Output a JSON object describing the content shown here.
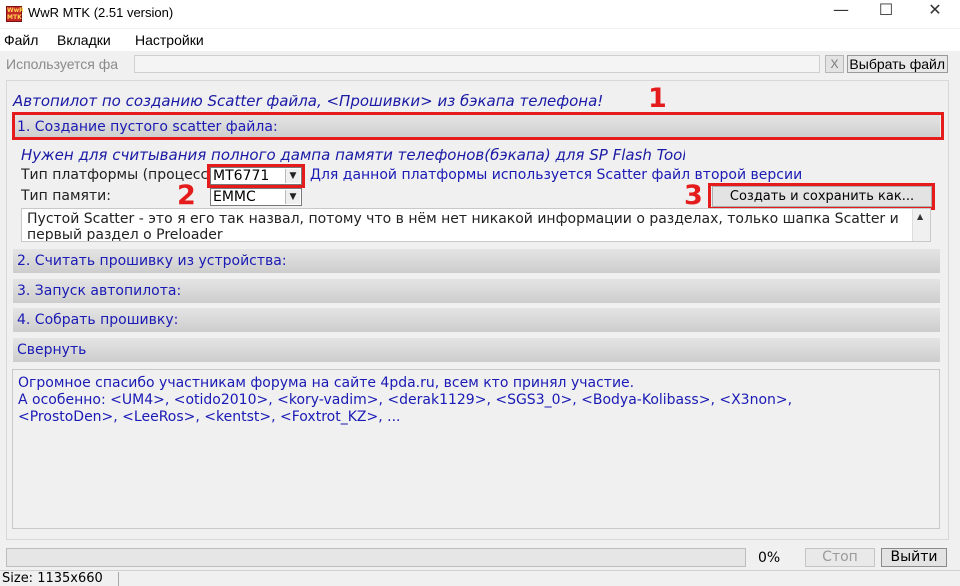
{
  "window": {
    "title": "WwR MTK (2.51 version)",
    "icon_text": "WwR MTK",
    "minimize": "—",
    "maximize": "☐",
    "close": "✕"
  },
  "menu": {
    "items": [
      "Файл",
      "Вкладки",
      "Настройки"
    ]
  },
  "file_row": {
    "label": "Используется фа",
    "path_value": "",
    "clear_label": "X",
    "browse_label": "Выбрать файл"
  },
  "autopilot": {
    "title": "Автопилот по созданию Scatter файла, <Прошивки> из бэкапа телефона!"
  },
  "sections": [
    {
      "label": "1. Создание пустого scatter файла:",
      "active": true
    },
    {
      "label": "2. Считать прошивку из устройства:"
    },
    {
      "label": "3. Запуск автопилота:"
    },
    {
      "label": "4. Собрать прошивку:"
    },
    {
      "label": "Свернуть"
    }
  ],
  "section1": {
    "description": "Нужен для считывания полного дампа памяти телефонов(бэкапа) для SP Flash Tool",
    "platform_label": "Тип платформы (процессор):",
    "platform_value": "MT6771",
    "platform_info": "Для данной платформы используется Scatter файл второй версии",
    "memory_label": "Тип памяти:",
    "memory_value": "EMMC",
    "create_button": "Создать и сохранить как...",
    "info_text": "Пустой Scatter - это я его так назвал, потому что в нём нет никакой информации о разделах, только шапка Scatter и первый раздел о Preloader"
  },
  "annotations": {
    "one": "1",
    "two": "2",
    "three": "3"
  },
  "credits": {
    "line1": "Огромное спасибо участникам форума на сайте 4pda.ru, всем кто принял участие.",
    "line2": "А особенно: <UM4>, <otido2010>, <kory-vadim>, <derak1129>, <SGS3_0>, <Bodya-Kolibass>, <X3non>,",
    "line3": "<ProstoDen>, <LeeRos>, <kentst>, <Foxtrot_KZ>, ..."
  },
  "bottom": {
    "progress_percent": 0,
    "percent_label": "0%",
    "stop_label": "Стоп",
    "exit_label": "Выйти"
  },
  "status": {
    "size_label": "Size: 1135x660"
  },
  "colors": {
    "accent_blue": "#1a1ab5",
    "annotation_red": "#e41c1c"
  }
}
